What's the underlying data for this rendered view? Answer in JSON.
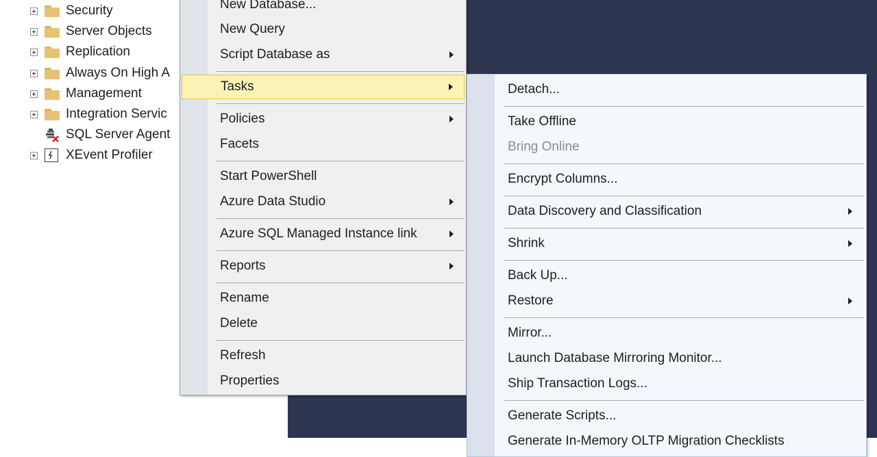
{
  "tree": {
    "items": [
      {
        "label": "Security",
        "icon": "folder-icon"
      },
      {
        "label": "Server Objects",
        "icon": "folder-icon"
      },
      {
        "label": "Replication",
        "icon": "folder-icon"
      },
      {
        "label": "Always On High A",
        "icon": "folder-icon"
      },
      {
        "label": "Management",
        "icon": "folder-icon"
      },
      {
        "label": "Integration Servic",
        "icon": "folder-icon"
      },
      {
        "label": "SQL Server Agent",
        "icon": "sql-agent-stopped-icon"
      },
      {
        "label": "XEvent Profiler",
        "icon": "xevent-profiler-icon"
      }
    ]
  },
  "context_menu": {
    "items": [
      {
        "label": "New Database..."
      },
      {
        "label": "New Query"
      },
      {
        "label": "Script Database as"
      },
      {
        "label": "Tasks"
      },
      {
        "label": "Policies"
      },
      {
        "label": "Facets"
      },
      {
        "label": "Start PowerShell"
      },
      {
        "label": "Azure Data Studio"
      },
      {
        "label": "Azure SQL Managed Instance link"
      },
      {
        "label": "Reports"
      },
      {
        "label": "Rename"
      },
      {
        "label": "Delete"
      },
      {
        "label": "Refresh"
      },
      {
        "label": "Properties"
      }
    ]
  },
  "tasks_submenu": {
    "items": [
      {
        "label": "Detach..."
      },
      {
        "label": "Take Offline"
      },
      {
        "label": "Bring Online"
      },
      {
        "label": "Encrypt Columns..."
      },
      {
        "label": "Data Discovery and Classification"
      },
      {
        "label": "Shrink"
      },
      {
        "label": "Back Up..."
      },
      {
        "label": "Restore"
      },
      {
        "label": "Mirror..."
      },
      {
        "label": "Launch Database Mirroring Monitor..."
      },
      {
        "label": "Ship Transaction Logs..."
      },
      {
        "label": "Generate Scripts..."
      },
      {
        "label": "Generate In-Memory OLTP Migration Checklists"
      }
    ]
  },
  "colors": {
    "highlight": "#fcf2b6",
    "background_dark": "#2d3550",
    "folder": "#e6c274"
  }
}
